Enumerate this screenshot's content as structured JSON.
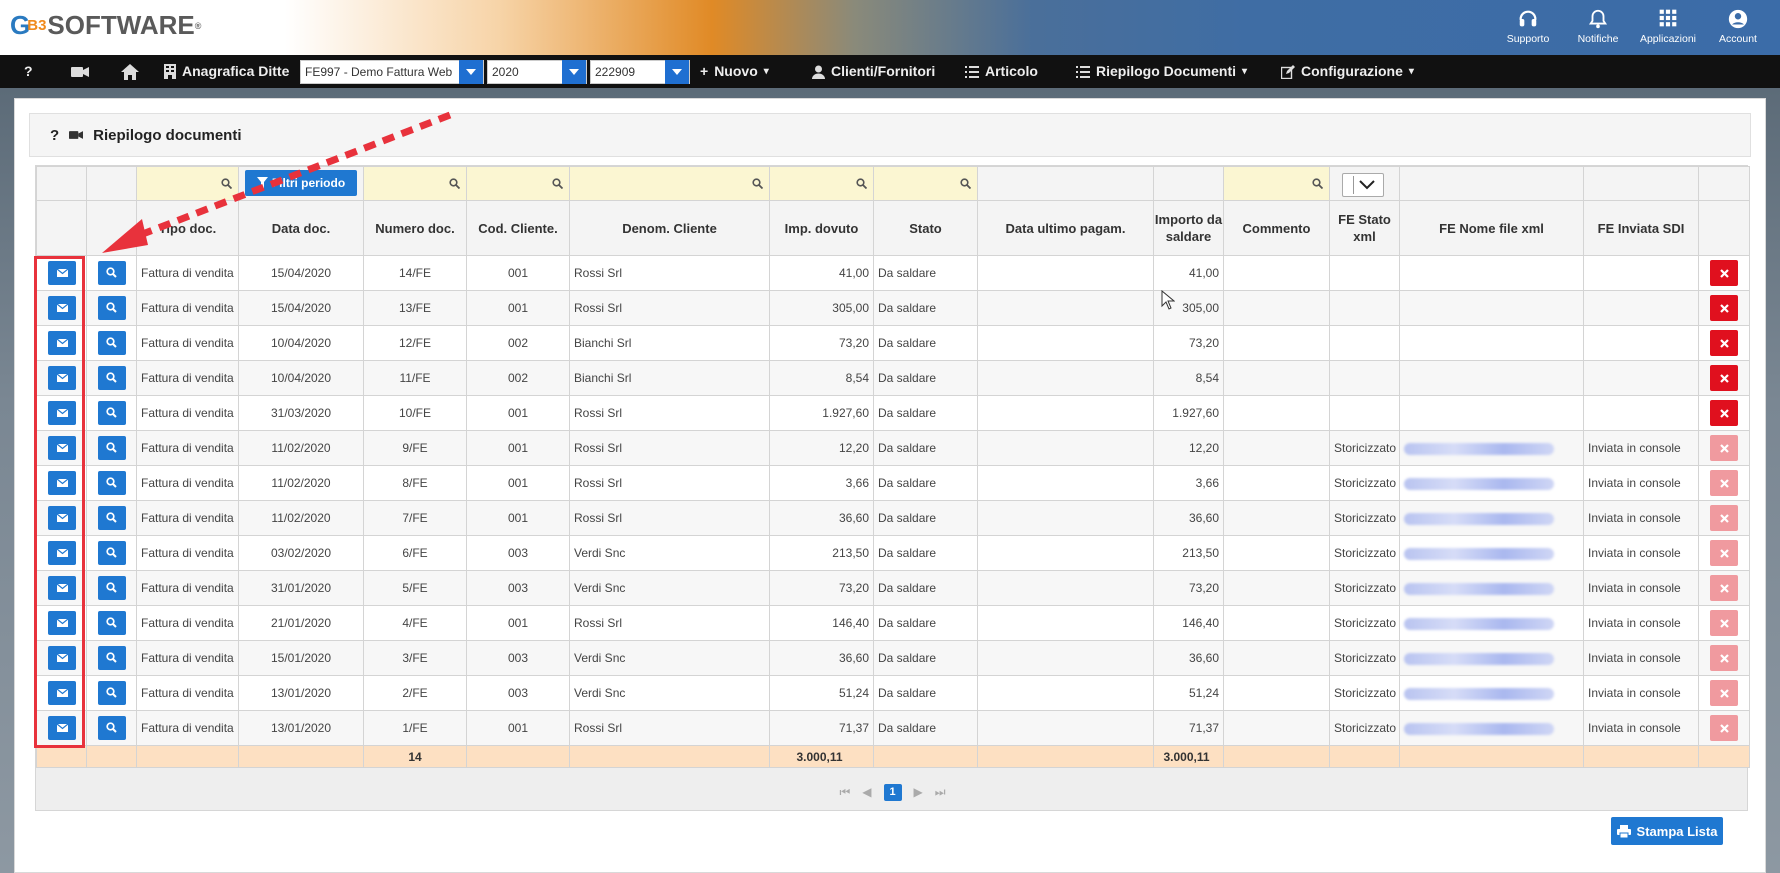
{
  "brand": {
    "logo_g": "G",
    "logo_b3": "B3",
    "logo_text": "SOFTWARE",
    "logo_mark": "®"
  },
  "topbar": {
    "items": [
      {
        "label": "Supporto",
        "icon": "headset-icon"
      },
      {
        "label": "Notifiche",
        "icon": "bell-icon"
      },
      {
        "label": "Applicazioni",
        "icon": "apps-grid-icon"
      },
      {
        "label": "Account",
        "icon": "account-icon"
      }
    ]
  },
  "navbar": {
    "help": "?",
    "anagrafica": "Anagrafica Ditte",
    "company_select": "FE997 - Demo Fattura Web",
    "year_select": "2020",
    "code_select": "222909",
    "nuovo": "Nuovo",
    "clienti": "Clienti/Fornitori",
    "articolo": "Articolo",
    "riepilogo": "Riepilogo Documenti",
    "configurazione": "Configurazione"
  },
  "panel": {
    "help": "?",
    "title": "Riepilogo documenti"
  },
  "filters": {
    "filtri_periodo": "Filtri periodo"
  },
  "columns": [
    "",
    "",
    "Tipo doc.",
    "Data doc.",
    "Numero doc.",
    "Cod. Cliente.",
    "Denom. Cliente",
    "Imp. dovuto",
    "Stato",
    "Data ultimo pagam.",
    "Importo da saldare",
    "Commento",
    "FE Stato xml",
    "FE Nome file xml",
    "FE Inviata SDI",
    ""
  ],
  "rows": [
    {
      "tipo": "Fattura di vendita",
      "data": "15/04/2020",
      "numero": "14/FE",
      "cod": "001",
      "denom": "Rossi Srl",
      "imp": "41,00",
      "stato": "Da saldare",
      "data_pag": "",
      "saldare": "41,00",
      "commento": "",
      "fe_stato": "",
      "fe_file": false,
      "fe_sdi": "",
      "deletable": true
    },
    {
      "tipo": "Fattura di vendita",
      "data": "15/04/2020",
      "numero": "13/FE",
      "cod": "001",
      "denom": "Rossi Srl",
      "imp": "305,00",
      "stato": "Da saldare",
      "data_pag": "",
      "saldare": "305,00",
      "commento": "",
      "fe_stato": "",
      "fe_file": false,
      "fe_sdi": "",
      "deletable": true
    },
    {
      "tipo": "Fattura di vendita",
      "data": "10/04/2020",
      "numero": "12/FE",
      "cod": "002",
      "denom": "Bianchi Srl",
      "imp": "73,20",
      "stato": "Da saldare",
      "data_pag": "",
      "saldare": "73,20",
      "commento": "",
      "fe_stato": "",
      "fe_file": false,
      "fe_sdi": "",
      "deletable": true
    },
    {
      "tipo": "Fattura di vendita",
      "data": "10/04/2020",
      "numero": "11/FE",
      "cod": "002",
      "denom": "Bianchi Srl",
      "imp": "8,54",
      "stato": "Da saldare",
      "data_pag": "",
      "saldare": "8,54",
      "commento": "",
      "fe_stato": "",
      "fe_file": false,
      "fe_sdi": "",
      "deletable": true
    },
    {
      "tipo": "Fattura di vendita",
      "data": "31/03/2020",
      "numero": "10/FE",
      "cod": "001",
      "denom": "Rossi Srl",
      "imp": "1.927,60",
      "stato": "Da saldare",
      "data_pag": "",
      "saldare": "1.927,60",
      "commento": "",
      "fe_stato": "",
      "fe_file": false,
      "fe_sdi": "",
      "deletable": true
    },
    {
      "tipo": "Fattura di vendita",
      "data": "11/02/2020",
      "numero": "9/FE",
      "cod": "001",
      "denom": "Rossi Srl",
      "imp": "12,20",
      "stato": "Da saldare",
      "data_pag": "",
      "saldare": "12,20",
      "commento": "",
      "fe_stato": "Storicizzato",
      "fe_file": true,
      "fe_sdi": "Inviata in console",
      "deletable": false
    },
    {
      "tipo": "Fattura di vendita",
      "data": "11/02/2020",
      "numero": "8/FE",
      "cod": "001",
      "denom": "Rossi Srl",
      "imp": "3,66",
      "stato": "Da saldare",
      "data_pag": "",
      "saldare": "3,66",
      "commento": "",
      "fe_stato": "Storicizzato",
      "fe_file": true,
      "fe_sdi": "Inviata in console",
      "deletable": false
    },
    {
      "tipo": "Fattura di vendita",
      "data": "11/02/2020",
      "numero": "7/FE",
      "cod": "001",
      "denom": "Rossi Srl",
      "imp": "36,60",
      "stato": "Da saldare",
      "data_pag": "",
      "saldare": "36,60",
      "commento": "",
      "fe_stato": "Storicizzato",
      "fe_file": true,
      "fe_sdi": "Inviata in console",
      "deletable": false
    },
    {
      "tipo": "Fattura di vendita",
      "data": "03/02/2020",
      "numero": "6/FE",
      "cod": "003",
      "denom": "Verdi Snc",
      "imp": "213,50",
      "stato": "Da saldare",
      "data_pag": "",
      "saldare": "213,50",
      "commento": "",
      "fe_stato": "Storicizzato",
      "fe_file": true,
      "fe_sdi": "Inviata in console",
      "deletable": false
    },
    {
      "tipo": "Fattura di vendita",
      "data": "31/01/2020",
      "numero": "5/FE",
      "cod": "003",
      "denom": "Verdi Snc",
      "imp": "73,20",
      "stato": "Da saldare",
      "data_pag": "",
      "saldare": "73,20",
      "commento": "",
      "fe_stato": "Storicizzato",
      "fe_file": true,
      "fe_sdi": "Inviata in console",
      "deletable": false
    },
    {
      "tipo": "Fattura di vendita",
      "data": "21/01/2020",
      "numero": "4/FE",
      "cod": "001",
      "denom": "Rossi Srl",
      "imp": "146,40",
      "stato": "Da saldare",
      "data_pag": "",
      "saldare": "146,40",
      "commento": "",
      "fe_stato": "Storicizzato",
      "fe_file": true,
      "fe_sdi": "Inviata in console",
      "deletable": false
    },
    {
      "tipo": "Fattura di vendita",
      "data": "15/01/2020",
      "numero": "3/FE",
      "cod": "003",
      "denom": "Verdi Snc",
      "imp": "36,60",
      "stato": "Da saldare",
      "data_pag": "",
      "saldare": "36,60",
      "commento": "",
      "fe_stato": "Storicizzato",
      "fe_file": true,
      "fe_sdi": "Inviata in console",
      "deletable": false
    },
    {
      "tipo": "Fattura di vendita",
      "data": "13/01/2020",
      "numero": "2/FE",
      "cod": "003",
      "denom": "Verdi Snc",
      "imp": "51,24",
      "stato": "Da saldare",
      "data_pag": "",
      "saldare": "51,24",
      "commento": "",
      "fe_stato": "Storicizzato",
      "fe_file": true,
      "fe_sdi": "Inviata in console",
      "deletable": false
    },
    {
      "tipo": "Fattura di vendita",
      "data": "13/01/2020",
      "numero": "1/FE",
      "cod": "001",
      "denom": "Rossi Srl",
      "imp": "71,37",
      "stato": "Da saldare",
      "data_pag": "",
      "saldare": "71,37",
      "commento": "",
      "fe_stato": "Storicizzato",
      "fe_file": true,
      "fe_sdi": "Inviata in console",
      "deletable": false
    }
  ],
  "totals": {
    "count": "14",
    "imp": "3.000,11",
    "saldare": "3.000,11"
  },
  "pager": {
    "current": "1"
  },
  "actions": {
    "stampa": "Stampa Lista"
  },
  "colors": {
    "accent": "#1f78d1",
    "danger": "#e0101e",
    "total_row": "#fde0c2",
    "filter_cell": "#fbf6d2",
    "annotation": "#e8323c"
  }
}
